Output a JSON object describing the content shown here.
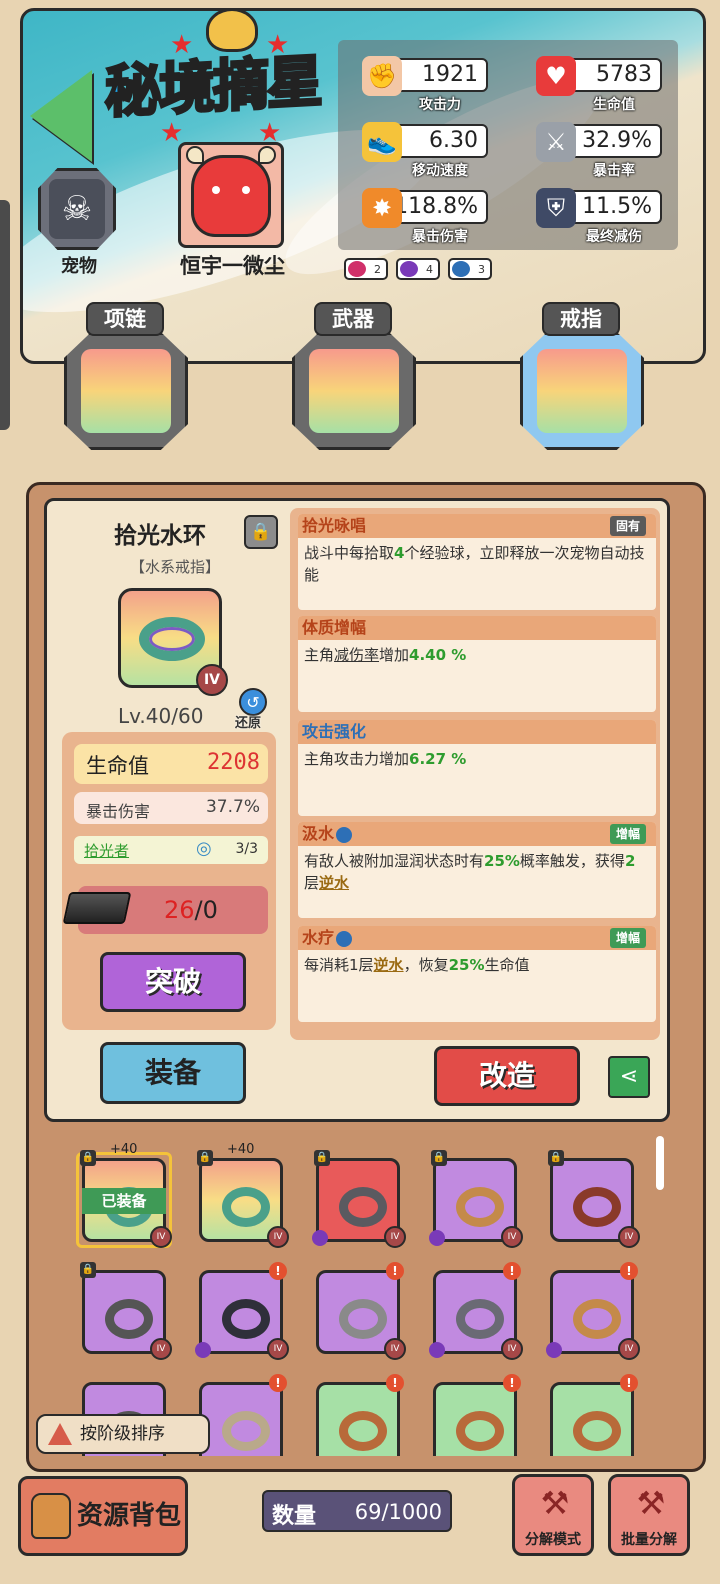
{
  "header": {
    "title": "秘境摘星",
    "pet_label": "宠物",
    "player_name": "恒宇一微尘",
    "stats": [
      {
        "icon": "fist-icon",
        "value": "1921",
        "label": "攻击力"
      },
      {
        "icon": "heart-icon",
        "value": "5783",
        "label": "生命值"
      },
      {
        "icon": "boot-icon",
        "value": "6.30",
        "label": "移动速度"
      },
      {
        "icon": "sword-icon",
        "value": "32.9%",
        "label": "暴击率"
      },
      {
        "icon": "explosion-icon",
        "value": "118.8%",
        "label": "暴击伤害"
      },
      {
        "icon": "shield-icon",
        "value": "11.5%",
        "label": "最终减伤"
      }
    ],
    "element_badges": [
      {
        "icon": "fire-element-icon",
        "count": "2",
        "color": "#d0306a"
      },
      {
        "icon": "spiral-element-icon",
        "count": "4",
        "color": "#7a3ab8"
      },
      {
        "icon": "water-element-icon",
        "count": "3",
        "color": "#2d6fb6"
      }
    ],
    "slots": [
      {
        "label": "项链"
      },
      {
        "label": "武器"
      },
      {
        "label": "戒指"
      }
    ]
  },
  "item": {
    "name": "拾光水环",
    "type": "【水系戒指】",
    "tier": "IV",
    "level": "Lv.40/60",
    "restore_label": "还原",
    "hp_label": "生命值",
    "hp_value": "2208",
    "crit_label": "暴击伤害",
    "crit_value": "37.7%",
    "set_name": "拾光者",
    "set_progress": "3/3",
    "material_have": "26",
    "material_need": "/0",
    "breakthrough_label": "突破",
    "equip_label": "装备",
    "reforge_label": "改造"
  },
  "skills": [
    {
      "name": "拾光咏唱",
      "tag": "固有",
      "pre": "战斗中每拾取",
      "hl": "4",
      "post": "个经验球，立即释放一次宠物自动技能"
    },
    {
      "name": "体质增幅",
      "pre": "主角",
      "ul": "减伤率",
      "mid": "增加",
      "hl": "4.40 %"
    },
    {
      "name": "攻击强化",
      "pre": "主角攻击力增加",
      "hl": "6.27 %"
    },
    {
      "name": "汲水",
      "tag": "增幅",
      "pre": "有敌人被附加湿润状态时有",
      "hl": "25%",
      "mid": "概率触发，获得",
      "hl2": "2",
      "mid2": "层",
      "gold": "逆水"
    },
    {
      "name": "水疗",
      "tag": "增幅",
      "pre": "每消耗1层",
      "gold": "逆水",
      "mid": "，恢复",
      "hl": "25%",
      "post": "生命值"
    }
  ],
  "inventory": {
    "equipped_tag": "已装备",
    "plus_label": "+40",
    "tier_label": "IV",
    "lock_glyph": "🔒",
    "alert_glyph": "!",
    "sort_label": "按阶级排序",
    "items": [
      {
        "color": "rainbow",
        "ring": "#4aa08a",
        "equipped": true,
        "plus": true,
        "locked": true
      },
      {
        "color": "rainbow",
        "ring": "#4aa08a",
        "plus": true,
        "locked": true
      },
      {
        "color": "red",
        "ring": "#5a5a60",
        "locked": true,
        "spiral": true
      },
      {
        "color": "purple",
        "ring": "#c48a4a",
        "locked": true,
        "spiral": true
      },
      {
        "color": "purple",
        "ring": "#8a3a2a",
        "locked": true
      },
      {
        "color": "purple",
        "ring": "#555",
        "locked": true
      },
      {
        "color": "purple",
        "ring": "#2f2f3a",
        "alert": true,
        "spiral": true
      },
      {
        "color": "purple",
        "ring": "#8a8a8a",
        "alert": true
      },
      {
        "color": "purple",
        "ring": "#6a6a74",
        "alert": true,
        "spiral": true
      },
      {
        "color": "purple",
        "ring": "#c48a4a",
        "alert": true,
        "spiral": true
      },
      {
        "color": "purple",
        "ring": "#555"
      },
      {
        "color": "purple",
        "ring": "#b9a98a",
        "alert": true
      },
      {
        "color": "green",
        "ring": "#b86a3a",
        "alert": true
      },
      {
        "color": "green",
        "ring": "#b86a3a",
        "alert": true
      },
      {
        "color": "green",
        "ring": "#b86a3a",
        "alert": true
      }
    ]
  },
  "footer": {
    "bag_label": "资源背包",
    "count_label": "数量",
    "count_value": "69/1000",
    "decompose_mode_label": "分解模式",
    "batch_decompose_label": "批量分解"
  }
}
